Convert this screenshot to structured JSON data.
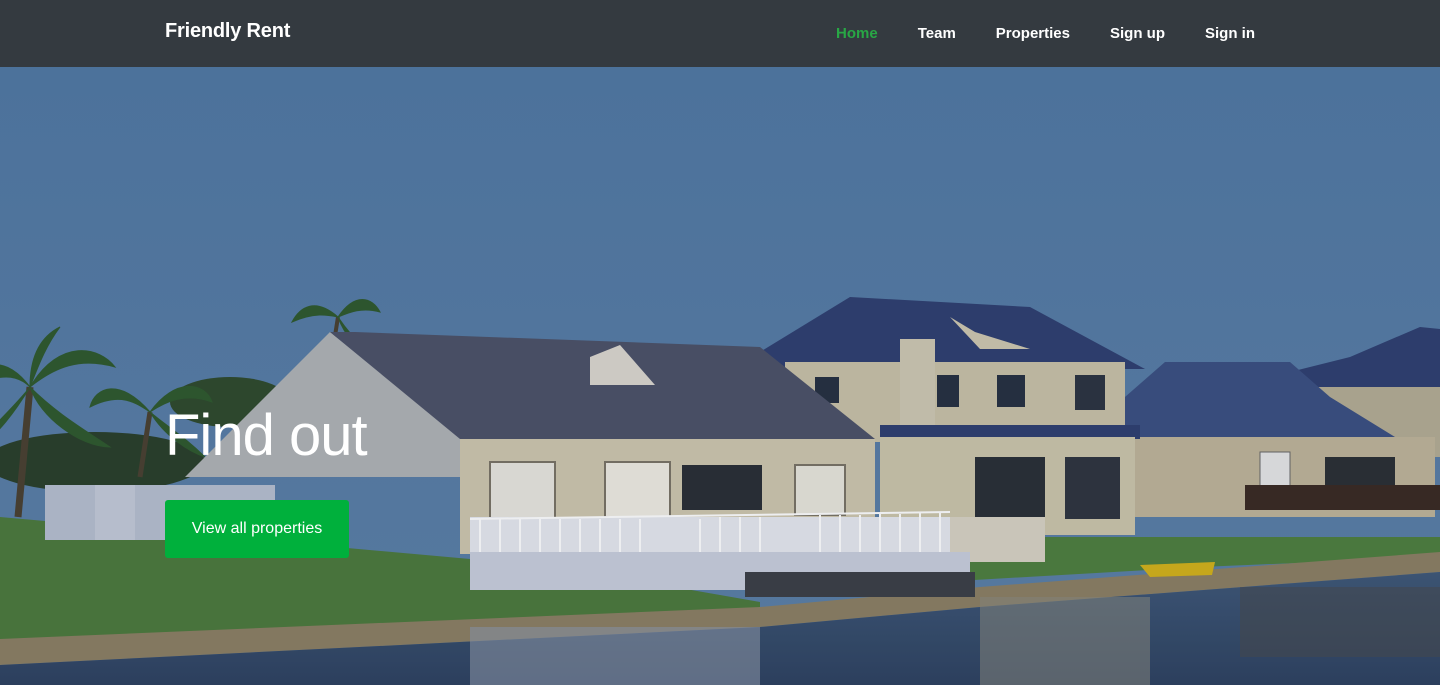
{
  "navbar": {
    "brand": "Friendly Rent",
    "links": [
      {
        "label": "Home",
        "active": true
      },
      {
        "label": "Team",
        "active": false
      },
      {
        "label": "Properties",
        "active": false
      },
      {
        "label": "Sign up",
        "active": false
      },
      {
        "label": "Sign in",
        "active": false
      }
    ]
  },
  "hero": {
    "title": "Find out",
    "button_label": "View all properties"
  },
  "colors": {
    "navbar_bg": "#343a40",
    "active_link": "#28a745",
    "button_bg": "#00b03c",
    "text": "#ffffff"
  }
}
